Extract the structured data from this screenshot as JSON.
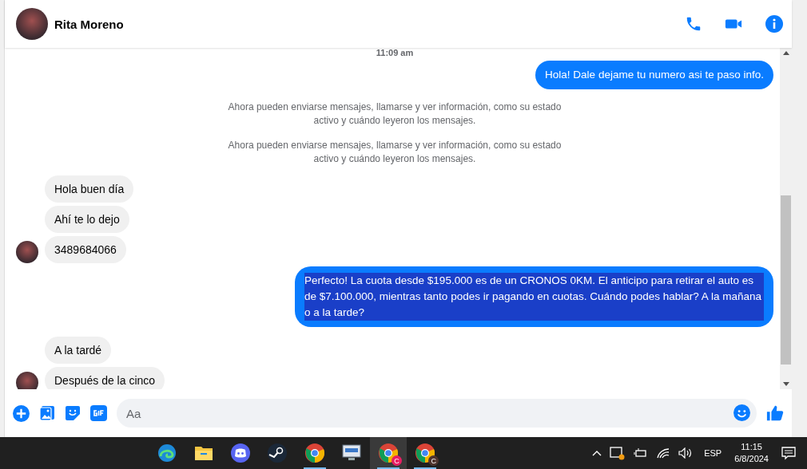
{
  "header": {
    "name": "Rita Moreno"
  },
  "timestamp": "11:09 am",
  "messages": [
    {
      "kind": "outgoing",
      "text": "Hola! Dale dejame tu numero  asi te paso info.",
      "highlighted": false
    },
    {
      "kind": "notice",
      "text": "Ahora pueden enviarse mensajes, llamarse y ver información, como su estado activo y cuándo leyeron los mensajes."
    },
    {
      "kind": "notice",
      "text": "Ahora pueden enviarse mensajes, llamarse y ver información, como su estado activo y cuándo leyeron los mensajes."
    },
    {
      "kind": "incoming",
      "text": "Hola buen día",
      "avatar": false
    },
    {
      "kind": "incoming",
      "text": "Ahí te lo dejo",
      "avatar": false
    },
    {
      "kind": "incoming",
      "text": "3489684066",
      "avatar": true
    },
    {
      "kind": "outgoing",
      "text": "Perfecto! La cuota desde $195.000 es de un CRONOS 0KM. El anticipo para retirar el auto es de $7.100.000, mientras tanto podes ir pagando en cuotas. Cuándo podes hablar? A la mañana o a la tarde?",
      "highlighted": true
    },
    {
      "kind": "incoming",
      "text": "A la tardé",
      "avatar": false
    },
    {
      "kind": "incoming",
      "text": "Después de la cinco",
      "avatar": true
    }
  ],
  "composer": {
    "placeholder": "Aa"
  },
  "taskbar": {
    "apps": [
      {
        "kind": "edge",
        "running": false,
        "active": false
      },
      {
        "kind": "folder",
        "running": false,
        "active": false
      },
      {
        "kind": "discord",
        "running": false,
        "active": false
      },
      {
        "kind": "steam",
        "running": false,
        "active": false
      },
      {
        "kind": "chrome",
        "running": true,
        "active": false
      },
      {
        "kind": "monitor",
        "running": false,
        "active": false
      },
      {
        "kind": "chrome",
        "running": true,
        "active": true,
        "badge": "C"
      },
      {
        "kind": "chrome",
        "running": true,
        "active": false,
        "badge": "C"
      }
    ],
    "language": "ESP",
    "time": "11:15",
    "date": "6/8/2024"
  }
}
